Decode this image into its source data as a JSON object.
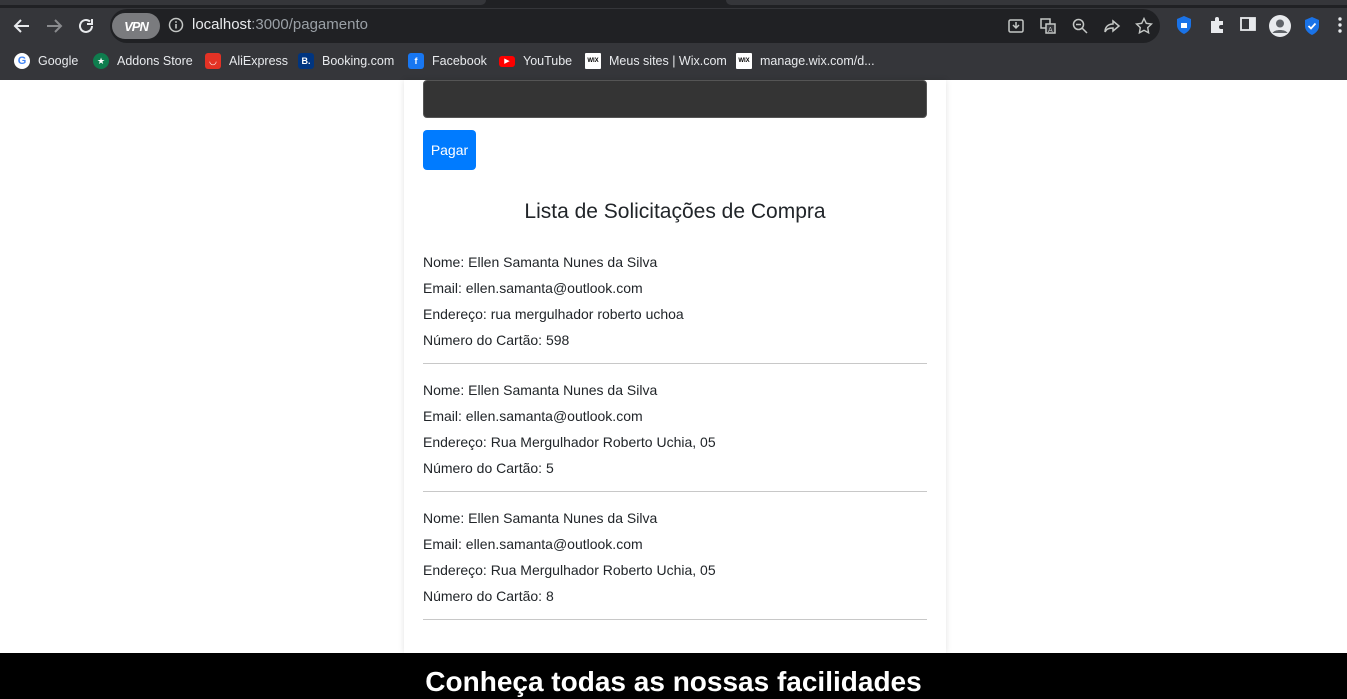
{
  "browser": {
    "vpn_label": "VPN",
    "url_host": "localhost",
    "url_rest": ":3000/pagamento",
    "bookmarks": [
      {
        "label": "Google",
        "icon": "google-icon",
        "color": "#ffffff"
      },
      {
        "label": "Addons Store",
        "icon": "addons-store-icon",
        "color": "#0f7d4e"
      },
      {
        "label": "AliExpress",
        "icon": "aliexpress-icon",
        "color": "#e43225"
      },
      {
        "label": "Booking.com",
        "icon": "booking-icon",
        "color": "#003580"
      },
      {
        "label": "Facebook",
        "icon": "facebook-icon",
        "color": "#1877f2"
      },
      {
        "label": "YouTube",
        "icon": "youtube-icon",
        "color": "#ff0000"
      },
      {
        "label": "Meus sites | Wix.com",
        "icon": "wix-icon",
        "color": "#ffffff"
      },
      {
        "label": "manage.wix.com/d...",
        "icon": "wix-icon",
        "color": "#ffffff"
      }
    ]
  },
  "payment": {
    "button_label": "Pagar",
    "button_color": "#007bff"
  },
  "list": {
    "title": "Lista de Solicitações de Compra",
    "entries": [
      {
        "nome": "Nome: Ellen Samanta Nunes da Silva",
        "email": "Email: ellen.samanta@outlook.com",
        "endereco": "Endereço: rua mergulhador roberto uchoa",
        "cartao": "Número do Cartão: 598"
      },
      {
        "nome": "Nome: Ellen Samanta Nunes da Silva",
        "email": "Email: ellen.samanta@outlook.com",
        "endereco": "Endereço: Rua Mergulhador Roberto Uchia, 05",
        "cartao": "Número do Cartão: 5"
      },
      {
        "nome": "Nome: Ellen Samanta Nunes da Silva",
        "email": "Email: ellen.samanta@outlook.com",
        "endereco": "Endereço: Rua Mergulhador Roberto Uchia, 05",
        "cartao": "Número do Cartão: 8"
      }
    ]
  },
  "footer": {
    "title": "Conheça todas as nossas facilidades"
  }
}
